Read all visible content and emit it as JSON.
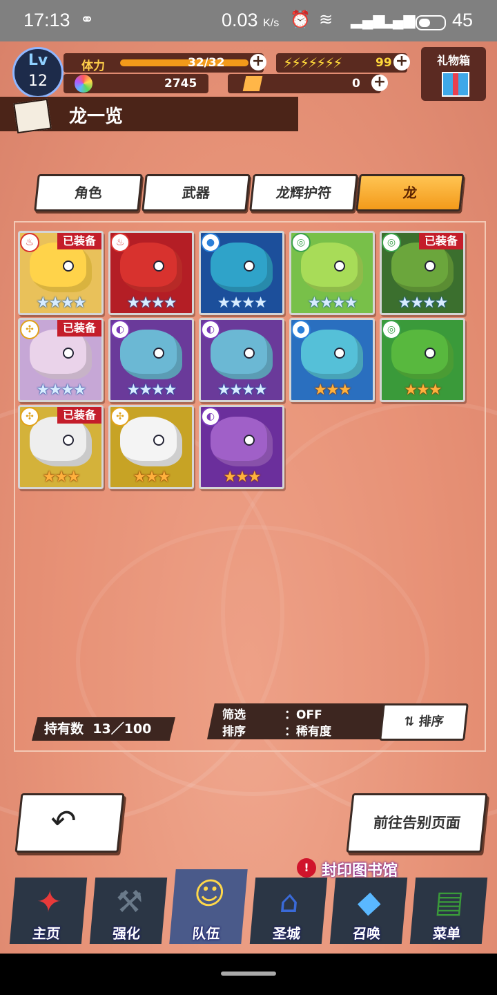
{
  "status_bar": {
    "time": "17:13",
    "net_speed": "0.03",
    "net_unit": "K/s",
    "battery": "45"
  },
  "hud": {
    "level_label": "Lv",
    "level": "12",
    "stamina_label": "体力",
    "stamina": "32/32",
    "energy": "99",
    "gems": "2745",
    "tickets": "0",
    "gift_label": "礼物箱"
  },
  "page_title": "龙一览",
  "tabs": [
    {
      "label": "角色",
      "active": false
    },
    {
      "label": "武器",
      "active": false
    },
    {
      "label": "龙辉护符",
      "active": false
    },
    {
      "label": "龙",
      "active": true
    }
  ],
  "equipped_label": "已装备",
  "dragons": [
    {
      "element": "fire",
      "stars": 4,
      "equipped": true,
      "bg": "#e9c15a",
      "art": "#ffd34a"
    },
    {
      "element": "fire",
      "stars": 4,
      "equipped": false,
      "bg": "#b41e25",
      "art": "#d8322e"
    },
    {
      "element": "water",
      "stars": 4,
      "equipped": false,
      "bg": "#1c4f9b",
      "art": "#2fa3c9"
    },
    {
      "element": "wind",
      "stars": 4,
      "equipped": false,
      "bg": "#78c049",
      "art": "#a8dc58"
    },
    {
      "element": "wind",
      "stars": 4,
      "equipped": true,
      "bg": "#3b6f2e",
      "art": "#6ba63c"
    },
    {
      "element": "light",
      "stars": 4,
      "equipped": true,
      "bg": "#c6a7d6",
      "art": "#ead3ea"
    },
    {
      "element": "shadow",
      "stars": 4,
      "equipped": false,
      "bg": "#6a3a9a",
      "art": "#6bb8d4"
    },
    {
      "element": "shadow",
      "stars": 4,
      "equipped": false,
      "bg": "#6a3a9a",
      "art": "#6bb8d4"
    },
    {
      "element": "water",
      "stars": 3,
      "equipped": false,
      "bg": "#2a6fbf",
      "art": "#55c0d8"
    },
    {
      "element": "wind",
      "stars": 3,
      "equipped": false,
      "bg": "#3a9a3a",
      "art": "#58b83e"
    },
    {
      "element": "light",
      "stars": 3,
      "equipped": true,
      "bg": "#d4b23a",
      "art": "#eeeeee"
    },
    {
      "element": "light",
      "stars": 3,
      "equipped": false,
      "bg": "#c7a325",
      "art": "#f4f4f4"
    },
    {
      "element": "shadow",
      "stars": 3,
      "equipped": false,
      "bg": "#6b2f9c",
      "art": "#a060c8"
    }
  ],
  "element_colors": {
    "fire": "#d8322e",
    "water": "#2a7fd8",
    "wind": "#3aa14a",
    "light": "#e1a21a",
    "shadow": "#7a3ab8"
  },
  "element_glyphs": {
    "fire": "♨",
    "water": "●",
    "wind": "◎",
    "light": "✣",
    "shadow": "◐"
  },
  "owned": {
    "label": "持有数",
    "value": "13／100"
  },
  "filter": {
    "label": "筛选",
    "value": "：OFF"
  },
  "sort": {
    "label": "排序",
    "value": "：稀有度"
  },
  "sort_button": "排序",
  "back_button_icon": "back-arrow-icon",
  "farewell_button": "前往告别页面",
  "seal_library": "封印图书馆",
  "nav": [
    {
      "label": "主页",
      "icon": "home-emblem-icon"
    },
    {
      "label": "强化",
      "icon": "hammer-icon"
    },
    {
      "label": "队伍",
      "icon": "party-icon"
    },
    {
      "label": "圣城",
      "icon": "castle-icon"
    },
    {
      "label": "召唤",
      "icon": "crystal-icon"
    },
    {
      "label": "菜单",
      "icon": "book-icon"
    }
  ]
}
